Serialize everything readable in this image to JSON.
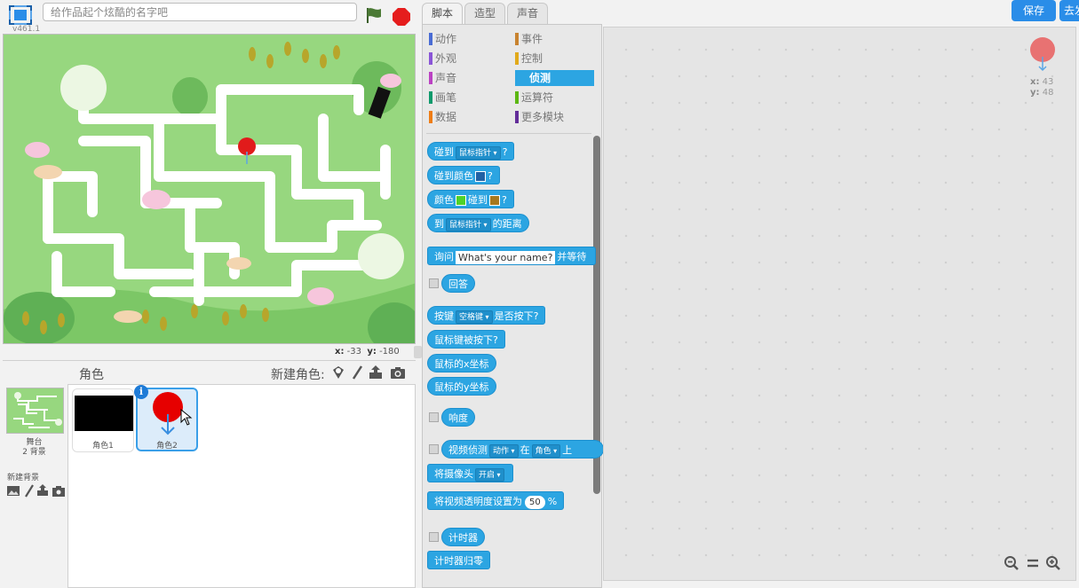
{
  "app": {
    "version": "v461.1",
    "title_placeholder": "给作品起个炫酷的名字吧"
  },
  "stage": {
    "mouse_x_label": "x:",
    "mouse_x": "-33",
    "mouse_y_label": "y:",
    "mouse_y": "-180"
  },
  "sprites_panel": {
    "title": "角色",
    "new_sprite_label": "新建角色:",
    "stage_label": "舞台",
    "stage_backdrops": "2 背景",
    "new_backdrop_label": "新建背景",
    "sprites": [
      {
        "name": "角色1"
      },
      {
        "name": "角色2"
      }
    ],
    "info_badge": "i"
  },
  "tabs": {
    "scripts": "脚本",
    "costumes": "造型",
    "sounds": "声音"
  },
  "top_right": {
    "save": "保存",
    "share": "去发布"
  },
  "categories": [
    {
      "label": "动作",
      "color": "#4a6cd4"
    },
    {
      "label": "事件",
      "color": "#c88330"
    },
    {
      "label": "外观",
      "color": "#8a55d7"
    },
    {
      "label": "控制",
      "color": "#e1a91a"
    },
    {
      "label": "声音",
      "color": "#bb42c3"
    },
    {
      "label": "侦测",
      "color": "#2ca5e2"
    },
    {
      "label": "画笔",
      "color": "#0e9a6c"
    },
    {
      "label": "运算符",
      "color": "#5cb712"
    },
    {
      "label": "数据",
      "color": "#ee7d16"
    },
    {
      "label": "更多模块",
      "color": "#632d99"
    }
  ],
  "blocks": {
    "touching": {
      "pre": "碰到",
      "dd": "鼠标指针",
      "post": "?"
    },
    "touching_color": {
      "pre": "碰到颜色",
      "post": "?"
    },
    "color_touching": {
      "pre": "颜色",
      "mid": "碰到",
      "post": "?"
    },
    "distance": {
      "pre": "到",
      "dd": "鼠标指针",
      "post": "的距离"
    },
    "ask": {
      "pre": "询问",
      "input": "What's your name?",
      "post": "并等待"
    },
    "answer": "回答",
    "key_pressed": {
      "pre": "按键",
      "dd": "空格键",
      "post": "是否按下?"
    },
    "mouse_down": "鼠标键被按下?",
    "mouse_x": "鼠标的x坐标",
    "mouse_y": "鼠标的y坐标",
    "loudness": "响度",
    "video_sensing": {
      "pre": "视频侦测",
      "dd1": "动作",
      "mid": "在",
      "dd2": "角色",
      "post": "上"
    },
    "turn_video": {
      "pre": "将摄像头",
      "dd": "开启"
    },
    "video_transparency": {
      "pre": "将视频透明度设置为",
      "value": "50",
      "post": "%"
    },
    "timer": "计时器",
    "reset_timer": "计时器归零"
  },
  "sprite_info": {
    "x_label": "x:",
    "x": "43",
    "y_label": "y:",
    "y": "48"
  },
  "colors": {
    "sensing": "#2ca5e2",
    "accent": "#2a8de8",
    "stage_grass": "#97d77f",
    "maze_path": "#ffffff"
  }
}
